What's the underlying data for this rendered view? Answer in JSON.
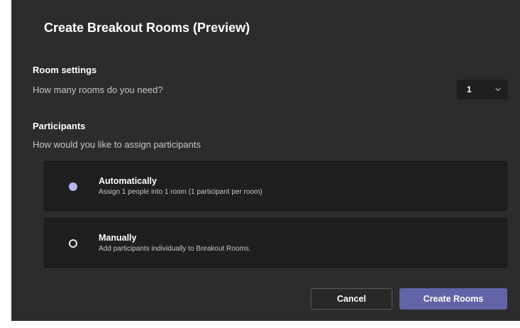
{
  "dialog": {
    "title": "Create Breakout Rooms (Preview)"
  },
  "room_settings": {
    "heading": "Room settings",
    "question": "How many rooms do you need?",
    "rooms_selected": "1"
  },
  "participants": {
    "heading": "Participants",
    "question": "How would you like to assign participants",
    "options": [
      {
        "title": "Automatically",
        "description": "Assign 1 people into 1 room (1 participant per room)",
        "selected": true
      },
      {
        "title": "Manually",
        "description": "Add participants individually to Breakout Rooms.",
        "selected": false
      }
    ]
  },
  "footer": {
    "cancel_label": "Cancel",
    "create_label": "Create Rooms"
  },
  "colors": {
    "dialog_background": "#2d2c2c",
    "card_background": "#201f1f",
    "accent": "#6264a7",
    "selected_radio": "#b8b6f0"
  }
}
